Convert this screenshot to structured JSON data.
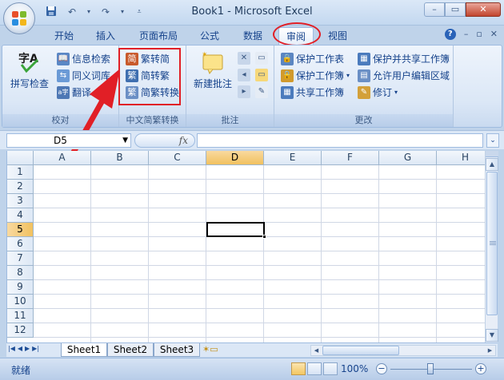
{
  "window": {
    "title": "Book1 - Microsoft Excel"
  },
  "tabs": [
    "开始",
    "插入",
    "页面布局",
    "公式",
    "数据",
    "审阅",
    "视图"
  ],
  "active_tab": "审阅",
  "ribbon": {
    "proofing": {
      "label": "校对",
      "spell": "拼写检查",
      "research": "信息检索",
      "thesaurus": "同义词库",
      "translate": "翻译"
    },
    "chinese": {
      "label": "中文简繁转换",
      "to_simplified": "繁转简",
      "to_traditional": "简转繁",
      "convert": "简繁转换"
    },
    "comments": {
      "label": "批注",
      "new_comment": "新建批注"
    },
    "changes": {
      "label": "更改",
      "protect_sheet": "保护工作表",
      "protect_workbook": "保护工作簿",
      "share_workbook": "共享工作簿",
      "protect_share": "保护并共享工作簿",
      "allow_edit": "允许用户编辑区域",
      "track": "修订"
    }
  },
  "formula_bar": {
    "name_box": "D5",
    "fx_label": "fx",
    "formula": ""
  },
  "columns": [
    "A",
    "B",
    "C",
    "D",
    "E",
    "F",
    "G",
    "H"
  ],
  "rows": [
    "1",
    "2",
    "3",
    "4",
    "5",
    "6",
    "7",
    "8",
    "9",
    "10",
    "11",
    "12"
  ],
  "selected_col": "D",
  "selected_row": "5",
  "sheets": [
    "Sheet1",
    "Sheet2",
    "Sheet3"
  ],
  "status": {
    "ready": "就绪",
    "zoom": "100%"
  },
  "colors": {
    "highlight": "#e11f26",
    "selection": "#f1c15f"
  }
}
